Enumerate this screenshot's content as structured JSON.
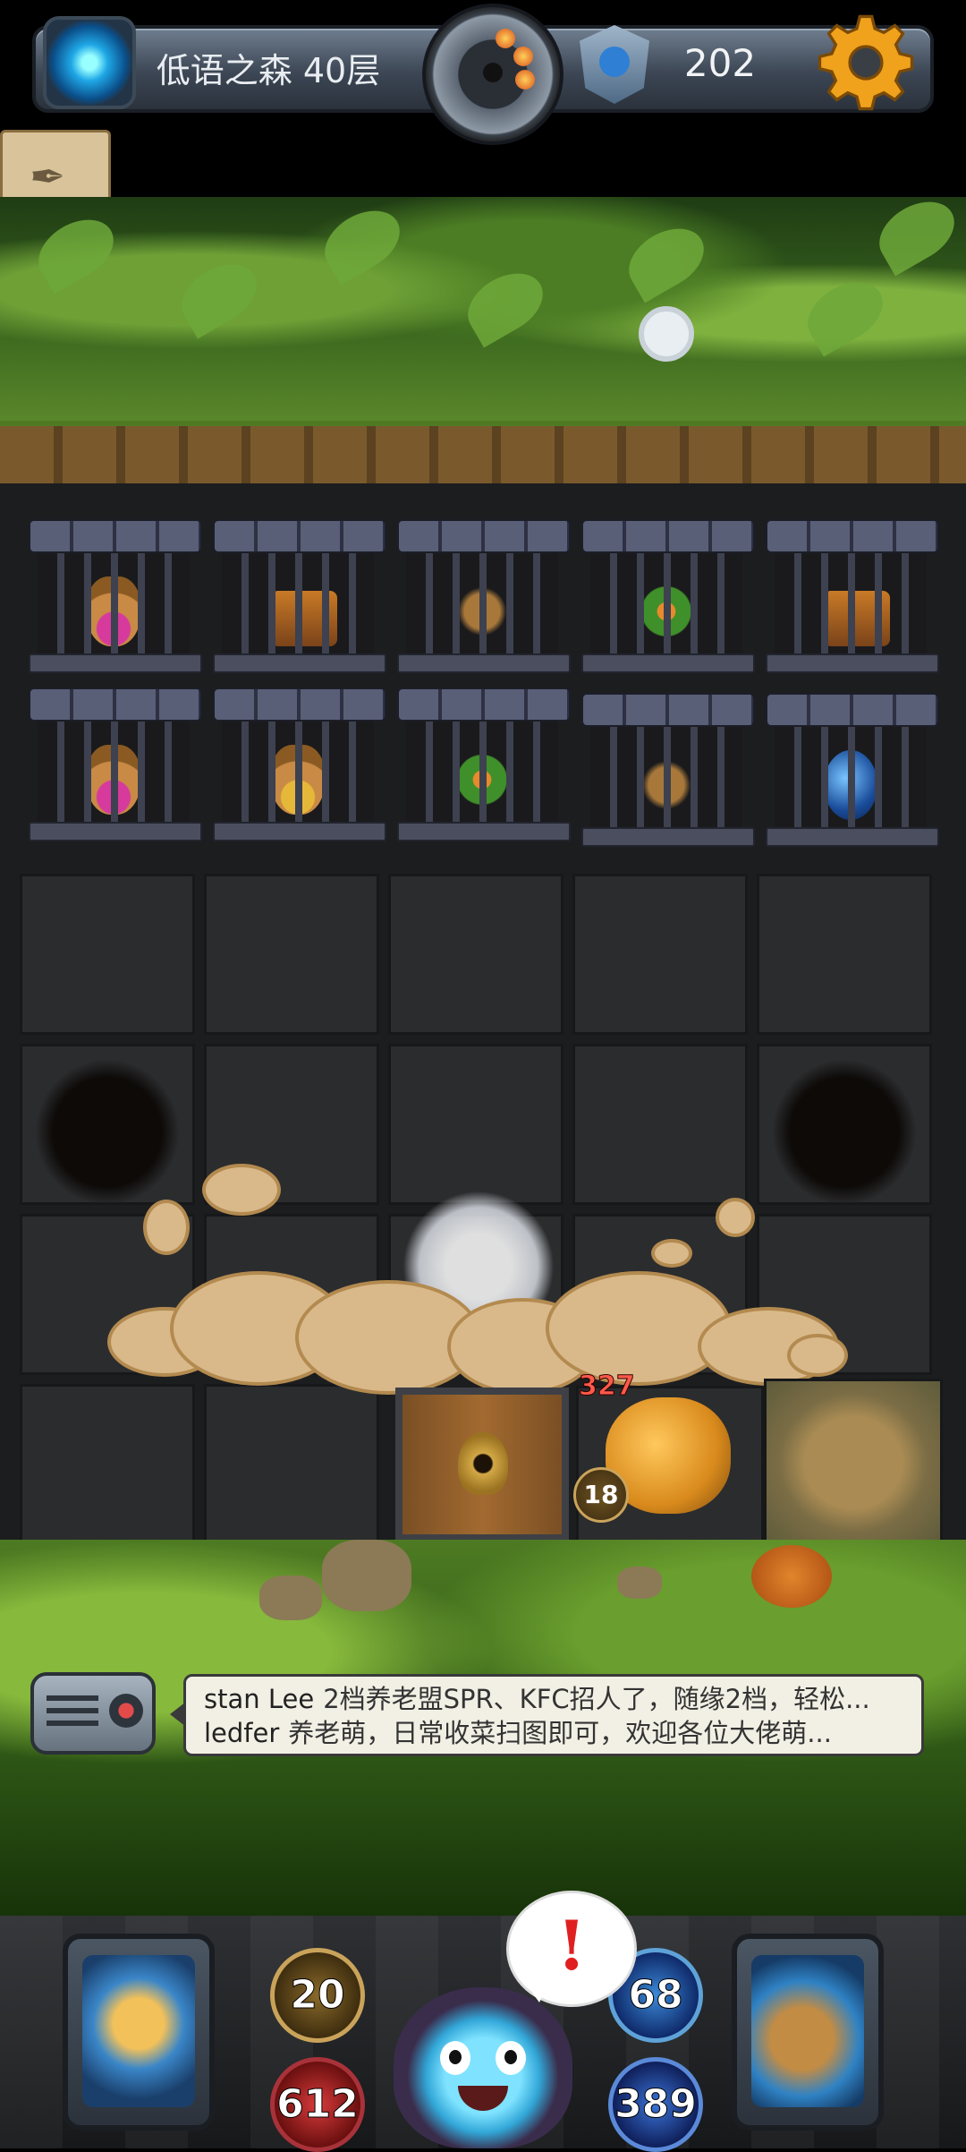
{
  "top_bar": {
    "floor_title": "低语之森 40层",
    "currency_value": "202",
    "icons": [
      "portal-icon",
      "bomb-medallion",
      "gem-icon",
      "settings-gear-icon"
    ]
  },
  "side_button": {
    "icon": "scroll-map-icon",
    "glyph": "✒"
  },
  "grid": {
    "cage_rows": [
      [
        "sack-pink",
        "chest",
        "brown",
        "plant",
        "chest"
      ],
      [
        "sack-pink",
        "sack-gold",
        "plant",
        "brown",
        "orb"
      ]
    ]
  },
  "hero": {
    "hp": "327",
    "attack_badge": "18"
  },
  "chat": {
    "messages": [
      {
        "name": "stan Lee",
        "text": "2档养老盟SPR、KFC招人了，随缘2档，轻松..."
      },
      {
        "name": "ledfer",
        "text": "养老萌，日常收菜扫图即可，欢迎各位大佬萌..."
      }
    ]
  },
  "hud": {
    "attack": "20",
    "hp": "612",
    "defense": "68",
    "mp": "389",
    "alert_symbol": "!",
    "colors": {
      "hp": "#d83b3b",
      "defense": "#3b89d8",
      "attack": "#caa35a"
    }
  }
}
